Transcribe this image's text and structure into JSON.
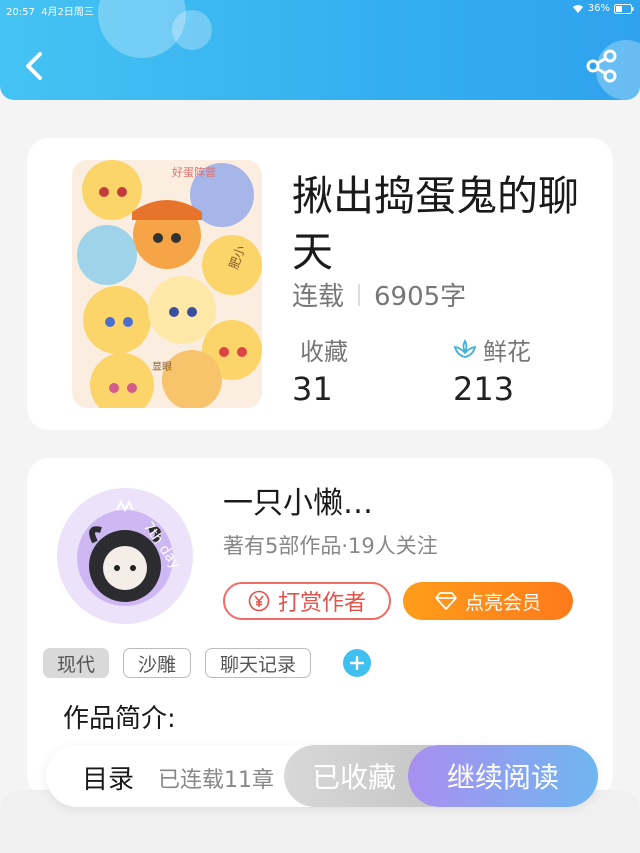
{
  "status_bar": {
    "time": "20:57",
    "date": "4月2日周三",
    "battery": "36%"
  },
  "header": {
    "back_icon": "chevron-left-icon",
    "share_icon": "share-icon"
  },
  "book": {
    "title": "揪出捣蛋鬼的聊天",
    "status": "连载",
    "word_count": "6905字",
    "favorites_label": "收藏",
    "favorites_value": "31",
    "flowers_label": "鲜花",
    "flowers_value": "213",
    "cover_text": {
      "badge": "好蛋阵营",
      "sign1": "肥小",
      "sign2": "显眼"
    }
  },
  "author": {
    "name": "一只小懒…",
    "avatar_text": "7th day",
    "stats": "著有5部作品·19人关注",
    "tip_button": "打赏作者",
    "vip_button": "点亮会员"
  },
  "tags": [
    "现代",
    "沙雕",
    "聊天记录"
  ],
  "intro_label": "作品简介:",
  "bottom_bar": {
    "toc": "目录",
    "chapter_count": "已连载11章",
    "collected": "已收藏",
    "continue": "继续阅读"
  },
  "colors": {
    "header": "#35aef0",
    "accent_red": "#e5524a",
    "accent_orange": "#ff8a1a",
    "tag_add": "#3fc0ee"
  }
}
